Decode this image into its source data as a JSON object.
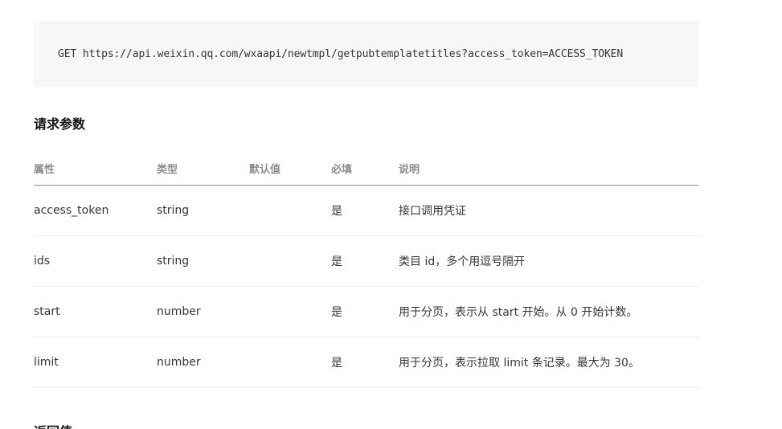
{
  "request": {
    "url_line": "GET https://api.weixin.qq.com/wxaapi/newtmpl/getpubtemplatetitles?access_token=ACCESS_TOKEN"
  },
  "params_section": {
    "title": "请求参数",
    "columns": [
      "属性",
      "类型",
      "默认值",
      "必填",
      "说明"
    ],
    "rows": [
      {
        "name": "access_token",
        "type": "string",
        "default": "",
        "required": "是",
        "desc": "接口调用凭证"
      },
      {
        "name": "ids",
        "type": "string",
        "default": "",
        "required": "是",
        "desc": "类目 id，多个用逗号隔开"
      },
      {
        "name": "start",
        "type": "number",
        "default": "",
        "required": "是",
        "desc": "用于分页，表示从 start 开始。从 0 开始计数。"
      },
      {
        "name": "limit",
        "type": "number",
        "default": "",
        "required": "是",
        "desc": "用于分页，表示拉取 limit 条记录。最大为 30。"
      }
    ]
  },
  "next_section": {
    "title": "返回值"
  },
  "colors": {
    "link": "#576b95",
    "code_bg": "#f7f7f7",
    "header_text": "#8c8c8c"
  }
}
